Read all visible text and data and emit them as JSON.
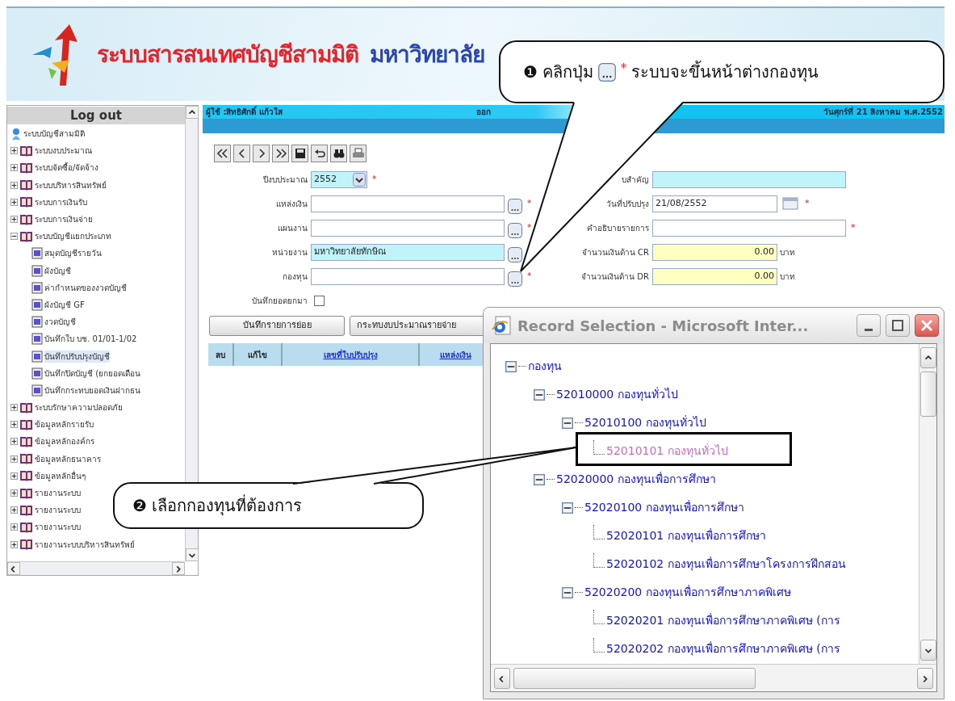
{
  "header": {
    "title": "ระบบสารสนเทศบัญชีสามมิติ",
    "subtitle": "มหาวิทยาลัย"
  },
  "sidebar": {
    "logout": "Log out",
    "root": "ระบบบัญชีสามมิติ",
    "items": [
      {
        "label": "ระบบงบประมาณ",
        "expanded": false
      },
      {
        "label": "ระบบจัดซื้อ/จัดจ้าง",
        "expanded": false
      },
      {
        "label": "ระบบบริหารสินทรัพย์",
        "expanded": false
      },
      {
        "label": "ระบบการเงินรับ",
        "expanded": false
      },
      {
        "label": "ระบบการเงินจ่าย",
        "expanded": false
      },
      {
        "label": "ระบบบัญชีแยกประเภท",
        "expanded": true,
        "children": [
          {
            "label": "สมุดบัญชีรายวัน",
            "selected": false
          },
          {
            "label": "ผังบัญชี",
            "selected": false
          },
          {
            "label": "ค่ากำหนดของงวดบัญชี",
            "selected": false
          },
          {
            "label": "ผังบัญชี GF",
            "selected": false
          },
          {
            "label": "งวดบัญชี",
            "selected": false
          },
          {
            "label": "บันทึกใบ บช. 01/01-1/02",
            "selected": false
          },
          {
            "label": "บันทึกปรับปรุงบัญชี",
            "selected": true
          },
          {
            "label": "บันทึกปิดบัญชี (ยกยอดเดือน",
            "selected": false
          },
          {
            "label": "บันทึกกระทบยอดเงินฝากธน",
            "selected": false
          }
        ]
      },
      {
        "label": "ระบบรักษาความปลอดภัย",
        "expanded": false
      },
      {
        "label": "ข้อมูลหลักรายรับ",
        "expanded": false
      },
      {
        "label": "ข้อมูลหลักองค์กร",
        "expanded": false
      },
      {
        "label": "ข้อมูลหลักธนาคาร",
        "expanded": false
      },
      {
        "label": "ข้อมูลหลักอื่นๆ",
        "expanded": false
      },
      {
        "label": "รายงานระบบ",
        "expanded": false
      },
      {
        "label": "รายงานระบบ",
        "expanded": false
      },
      {
        "label": "รายงานระบบ",
        "expanded": false
      },
      {
        "label": "รายงานระบบบริหารสินทรัพย์",
        "expanded": false
      }
    ]
  },
  "user_bar": {
    "user": "ผู้ใช้ :สิทธิศักดิ์ แก้วใส",
    "note": "ออก",
    "date": "วันศุกร์ที่ 21 สิงหาคม พ.ศ.2552"
  },
  "form": {
    "left": [
      {
        "kind": "select",
        "label": "ปีงบประมาณ",
        "value": "2552",
        "readonly": true,
        "required": "*"
      },
      {
        "kind": "lookup",
        "label": "แหล่งเงิน",
        "readonly": false,
        "required": "*"
      },
      {
        "kind": "lookup",
        "label": "แผนงาน",
        "readonly": false,
        "required": "*"
      },
      {
        "kind": "lookup",
        "label": "หน่วยงาน",
        "value": "มหาวิทยาลัยทักษิณ",
        "readonly": true
      },
      {
        "kind": "lookup",
        "label": "กองทุน",
        "readonly": false,
        "required": "*"
      }
    ],
    "carry_forward": {
      "label": "บันทึกยอดยกมา",
      "checked": false
    },
    "right": [
      {
        "kind": "text",
        "label": "บสำคัญ",
        "readonly": true
      },
      {
        "kind": "date",
        "label": "วันที่ปรับปรุง",
        "value": "21/08/2552",
        "readonly": false,
        "required": "*"
      },
      {
        "kind": "text",
        "label": "คำอธิบายรายการ",
        "readonly": false,
        "required": "*"
      },
      {
        "kind": "amount",
        "label": "จำนวนเงินด้าน CR",
        "value": "0.00",
        "unit": "บาท"
      },
      {
        "kind": "amount",
        "label": "จำนวนเงินด้าน DR",
        "value": "0.00",
        "unit": "บาท"
      }
    ]
  },
  "buttons": [
    "บันทึกรายการย่อย",
    "กระทบงบประมาณรายจ่าย"
  ],
  "table": {
    "columns": [
      {
        "label": "ลบ",
        "kind": "plain"
      },
      {
        "label": "แก้ไข",
        "kind": "plain"
      },
      {
        "label": "เลขที่ใบปรับปรุง",
        "kind": "link"
      },
      {
        "label": "แหล่งเงิน",
        "kind": "link"
      }
    ]
  },
  "popup": {
    "title": "Record Selection - Microsoft Inter...",
    "tree": [
      {
        "label": "กองทุน",
        "expanded": true,
        "selected": false,
        "children": [
          {
            "label": "52010000 กองทุนทั่วไป",
            "expanded": true,
            "selected": false,
            "children": [
              {
                "label": "52010100 กองทุนทั่วไป",
                "expanded": true,
                "selected": false,
                "children": [
                  {
                    "label": "52010101 กองทุนทั่วไป",
                    "selected": true
                  }
                ]
              }
            ]
          },
          {
            "label": "52020000 กองทุนเพื่อการศึกษา",
            "expanded": true,
            "selected": false,
            "children": [
              {
                "label": "52020100 กองทุนเพื่อการศึกษา",
                "expanded": true,
                "selected": false,
                "children": [
                  {
                    "label": "52020101 กองทุนเพื่อการศึกษา",
                    "selected": false
                  },
                  {
                    "label": "52020102 กองทุนเพื่อการศึกษาโครงการฝึกสอน",
                    "selected": false
                  }
                ]
              },
              {
                "label": "52020200 กองทุนเพื่อการศึกษาภาคพิเศษ",
                "expanded": true,
                "selected": false,
                "children": [
                  {
                    "label": "52020201 กองทุนเพื่อการศึกษาภาคพิเศษ (การ",
                    "selected": false
                  },
                  {
                    "label": "52020202 กองทุนเพื่อการศึกษาภาคพิเศษ (การ",
                    "selected": false
                  }
                ]
              }
            ]
          }
        ]
      }
    ]
  },
  "callouts": [
    {
      "number": "❶",
      "parts": [
        {
          "kind": "text",
          "text": "คลิกปุ่ม"
        },
        {
          "kind": "lookup-icon"
        },
        {
          "kind": "required",
          "text": "*"
        },
        {
          "kind": "text",
          "text": "ระบบจะขึ้นหน้าต่างกองทุน"
        }
      ]
    },
    {
      "number": "❷",
      "parts": [
        {
          "kind": "text",
          "text": "เลือกกองทุนที่ต้องการ"
        }
      ]
    }
  ]
}
